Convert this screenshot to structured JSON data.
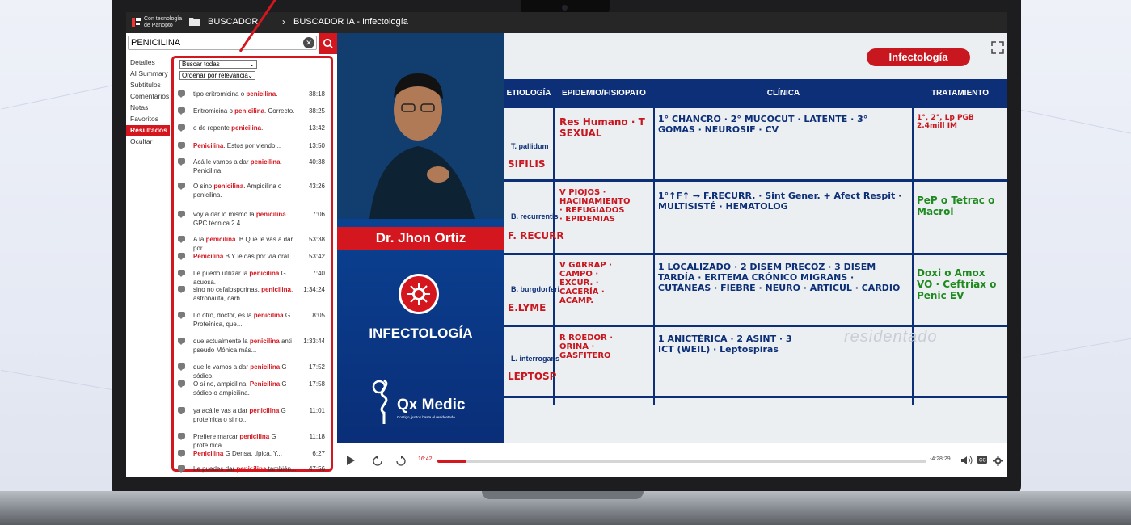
{
  "topbar": {
    "powered_by": "Con tecnología de Panopto",
    "folder_label": "BUSCADOR",
    "breadcrumb": "BUSCADOR IA - Infectología"
  },
  "search": {
    "value": "PENICILINA",
    "clear_icon": "close-circle-icon",
    "search_icon": "search-icon"
  },
  "sidebar": {
    "items": [
      {
        "label": "Detalles",
        "active": false
      },
      {
        "label": "AI Summary",
        "active": false
      },
      {
        "label": "Subtítulos",
        "active": false
      },
      {
        "label": "Comentarios",
        "active": false
      },
      {
        "label": "Notas",
        "active": false
      },
      {
        "label": "Favoritos",
        "active": false
      },
      {
        "label": "Resultados",
        "active": true
      },
      {
        "label": "Ocultar",
        "active": false
      }
    ]
  },
  "filters": {
    "scope": "Buscar todas",
    "sort": "Ordenar por relevancia"
  },
  "results": [
    {
      "before": "tipo eritromicina o ",
      "kw": "penicilina",
      "after": ".",
      "time": "38:18"
    },
    {
      "before": "Eritromicina o ",
      "kw": "penicilina",
      "after": ". Correcto.",
      "time": "38:25"
    },
    {
      "before": "o de repente ",
      "kw": "penicilina",
      "after": ".",
      "time": "13:42"
    },
    {
      "before": "",
      "kw": "Penicilina",
      "after": ". Estos por viendo...",
      "time": "13:50"
    },
    {
      "before": "Acá le vamos a dar ",
      "kw": "penicilina",
      "after": ". Penicilina.",
      "time": "40:38"
    },
    {
      "before": "O sino ",
      "kw": "penicilina",
      "after": ". Ampicilina o penicilina.",
      "time": "43:26"
    },
    {
      "before": "voy a dar lo mismo la ",
      "kw": "penicilina",
      "after": " GPC técnica 2.4...",
      "time": "7:06"
    },
    {
      "before": "A la ",
      "kw": "penicilina",
      "after": ". B Que le vas a dar por...",
      "time": "53:38"
    },
    {
      "before": "",
      "kw": "Penicilina",
      "after": " B Y le das por vía oral.",
      "time": "53:42"
    },
    {
      "before": "Le puedo utilizar la ",
      "kw": "penicilina",
      "after": " G acuosa.",
      "time": "7:40"
    },
    {
      "before": "sino no cefalosporinas, ",
      "kw": "penicilina",
      "after": ", astronauta, carb...",
      "time": "1:34:24"
    },
    {
      "before": "Lo otro, doctor, es la ",
      "kw": "penicilina",
      "after": " G Proteínica, que...",
      "time": "8:05"
    },
    {
      "before": "que actualmente la ",
      "kw": "penicilina",
      "after": " anti pseudo Mónica más...",
      "time": "1:33:44"
    },
    {
      "before": "que le vamos a dar ",
      "kw": "penicilina",
      "after": " G sódico.",
      "time": "17:52"
    },
    {
      "before": "O si no, ampicilina. ",
      "kw": "Penicilina",
      "after": " G sódico o ampicilina.",
      "time": "17:58"
    },
    {
      "before": "ya acá le vas a dar ",
      "kw": "penicilina",
      "after": " G proteínica o si no...",
      "time": "11:01"
    },
    {
      "before": "Prefiere marcar ",
      "kw": "penicilina",
      "after": " G proteínica.",
      "time": "11:18"
    },
    {
      "before": "",
      "kw": "Penicilina",
      "after": " G Densa, típica. Y...",
      "time": "6:27"
    },
    {
      "before": "Le puedes dar ",
      "kw": "penicilina",
      "after": " también...",
      "time": "47:56"
    }
  ],
  "video": {
    "presenter_name": "Dr. Jhon Ortiz",
    "panel_label": "INFECTOLOGÍA",
    "brand": "Qx Medic",
    "tagline": "Contigo, juntos hasta el residentado",
    "slide_title": "Infectología",
    "columns": [
      "ETIOLOGÍA",
      "EPIDEMIO/FISIOPATO",
      "CLÍNICA",
      "TRATAMIENTO"
    ],
    "rows": [
      {
        "organism": "T. pallidum",
        "disease": "SIFILIS",
        "epi": "Res Humano · T SEXUAL",
        "clinic": "1° CHANCRO · 2° MUCOCUT · LATENTE · 3° GOMAS · NEUROSIF · CV",
        "tx": "1°, 2°, Lp PGB 2.4mill IM"
      },
      {
        "organism": "B. recurrentis",
        "disease": "F. RECURR",
        "epi": "V PIOJOS · HACINAMIENTO · REFUGIADOS · EPIDEMIAS",
        "clinic": "1°↑F↑ → F.RECURR. · Sint Gener. + Afect Respit · MULTISISTÉ · HEMATOLOG",
        "tx": "PeP o Tetrac o Macrol"
      },
      {
        "organism": "B. burgdorferi",
        "disease": "E.LYME",
        "epi": "V GARRAP · CAMPO · EXCUR. · CACERÍA · ACAMP.",
        "clinic": "1 LOCALIZADO · 2 DISEM PRECOZ · 3 DISEM TARDÍA · ERITEMA CRÓNICO MIGRANS · CUTÁNEAS · FIEBRE · NEURO · ARTICUL · CARDIO",
        "tx": "Doxi o Amox VO · Ceftriax o Penic EV"
      },
      {
        "organism": "L. interrogans",
        "disease": "LEPTOSP",
        "epi": "R ROEDOR · ORINA · GASFITERO",
        "clinic": "1 ANICTÉRICA · 2 ASINT · 3 ICT (WEIL) · Leptospiras",
        "tx": ""
      }
    ],
    "watermark": "residentado",
    "current_time": "16:42",
    "remaining_time": "-4:28:29",
    "progress_fraction": 0.059,
    "controls_icons": [
      "play-icon",
      "rewind-10-icon",
      "forward-10-icon",
      "volume-icon",
      "captions-icon",
      "settings-icon",
      "fullscreen-icon"
    ]
  },
  "colors": {
    "accent": "#d4171f",
    "topbar": "#262626",
    "slide_navy": "#0c2f77"
  }
}
